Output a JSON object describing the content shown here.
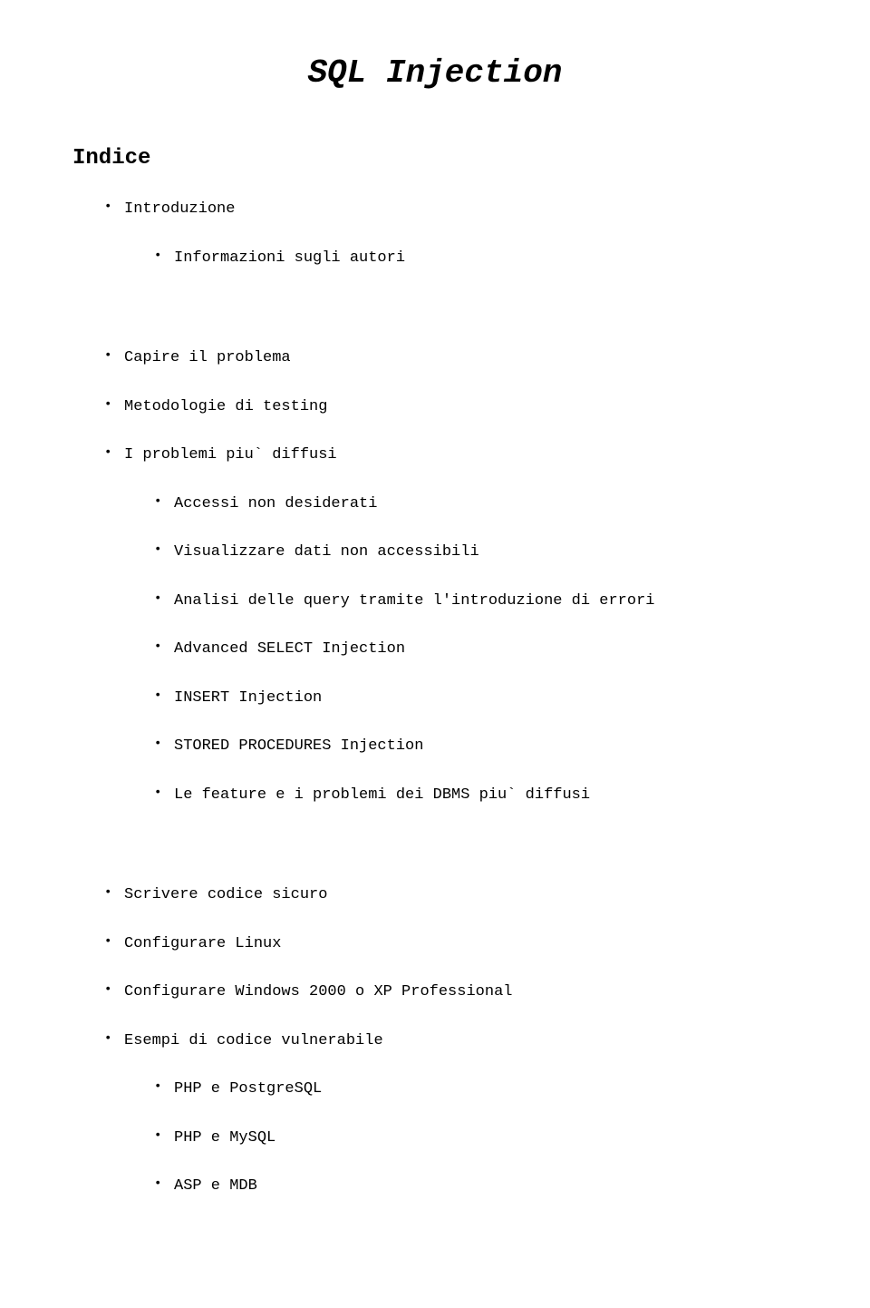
{
  "title": "SQL Injection",
  "indexHeading": "Indice",
  "items": {
    "introduzione": "Introduzione",
    "infoAutori": "Informazioni sugli autori",
    "capireProblema": "Capire il problema",
    "metodologie": "Metodologie di testing",
    "problemiDiffusi": "I problemi piu` diffusi",
    "accessi": "Accessi non desiderati",
    "visualizzare": "Visualizzare dati non accessibili",
    "analisi": "Analisi delle query tramite l'introduzione di errori",
    "advancedSelect": "Advanced SELECT Injection",
    "insertInjection": "INSERT Injection",
    "storedProcedures": "STORED PROCEDURES Injection",
    "featureDbms": "Le feature e i problemi dei DBMS piu` diffusi",
    "scrivereCodice": "Scrivere codice sicuro",
    "configLinux": "Configurare Linux",
    "configWindows": "Configurare Windows 2000 o XP Professional",
    "esempiCodice": "Esempi di codice vulnerabile",
    "phpPostgres": "PHP e PostgreSQL",
    "phpMysql": "PHP e MySQL",
    "aspMdb": "ASP e MDB"
  }
}
